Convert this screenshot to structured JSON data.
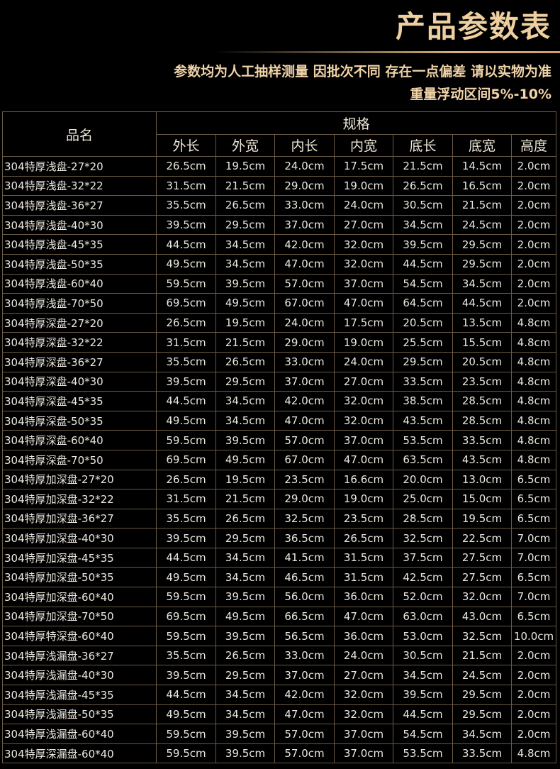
{
  "header": {
    "title": "产品参数表",
    "subtitle_line1": "参数均为人工抽样测量 因批次不同 存在一点偏差 请以实物为准",
    "subtitle_line2": "重量浮动区间5%-10%"
  },
  "table": {
    "name_header": "品名",
    "spec_header": "规格",
    "columns": [
      "外长",
      "外宽",
      "内长",
      "内宽",
      "底长",
      "底宽",
      "高度"
    ],
    "rows": [
      [
        "304特厚浅盘-27*20",
        "26.5cm",
        "19.5cm",
        "24.0cm",
        "17.5cm",
        "21.5cm",
        "14.5cm",
        "2.0cm"
      ],
      [
        "304特厚浅盘-32*22",
        "31.5cm",
        "21.5cm",
        "29.0cm",
        "19.0cm",
        "26.5cm",
        "16.5cm",
        "2.0cm"
      ],
      [
        "304特厚浅盘-36*27",
        "35.5cm",
        "26.5cm",
        "33.0cm",
        "24.0cm",
        "30.5cm",
        "21.5cm",
        "2.0cm"
      ],
      [
        "304特厚浅盘-40*30",
        "39.5cm",
        "29.5cm",
        "37.0cm",
        "27.0cm",
        "34.5cm",
        "24.5cm",
        "2.0cm"
      ],
      [
        "304特厚浅盘-45*35",
        "44.5cm",
        "34.5cm",
        "42.0cm",
        "32.0cm",
        "39.5cm",
        "29.5cm",
        "2.0cm"
      ],
      [
        "304特厚浅盘-50*35",
        "49.5cm",
        "34.5cm",
        "47.0cm",
        "32.0cm",
        "44.5cm",
        "29.5cm",
        "2.0cm"
      ],
      [
        "304特厚浅盘-60*40",
        "59.5cm",
        "39.5cm",
        "57.0cm",
        "37.0cm",
        "54.5cm",
        "34.5cm",
        "2.0cm"
      ],
      [
        "304特厚浅盘-70*50",
        "69.5cm",
        "49.5cm",
        "67.0cm",
        "47.0cm",
        "64.5cm",
        "44.5cm",
        "2.0cm"
      ],
      [
        "304特厚深盘-27*20",
        "26.5cm",
        "19.5cm",
        "24.0cm",
        "17.5cm",
        "20.5cm",
        "13.5cm",
        "4.8cm"
      ],
      [
        "304特厚深盘-32*22",
        "31.5cm",
        "21.5cm",
        "29.0cm",
        "19.0cm",
        "25.5cm",
        "15.5cm",
        "4.8cm"
      ],
      [
        "304特厚深盘-36*27",
        "35.5cm",
        "26.5cm",
        "33.0cm",
        "24.0cm",
        "29.5cm",
        "20.5cm",
        "4.8cm"
      ],
      [
        "304特厚深盘-40*30",
        "39.5cm",
        "29.5cm",
        "37.0cm",
        "27.0cm",
        "33.5cm",
        "23.5cm",
        "4.8cm"
      ],
      [
        "304特厚深盘-45*35",
        "44.5cm",
        "34.5cm",
        "42.0cm",
        "32.0cm",
        "38.5cm",
        "28.5cm",
        "4.8cm"
      ],
      [
        "304特厚深盘-50*35",
        "49.5cm",
        "34.5cm",
        "47.0cm",
        "32.0cm",
        "43.5cm",
        "28.5cm",
        "4.8cm"
      ],
      [
        "304特厚深盘-60*40",
        "59.5cm",
        "39.5cm",
        "57.0cm",
        "37.0cm",
        "53.5cm",
        "33.5cm",
        "4.8cm"
      ],
      [
        "304特厚深盘-70*50",
        "69.5cm",
        "49.5cm",
        "67.0cm",
        "47.0cm",
        "63.5cm",
        "43.5cm",
        "4.8cm"
      ],
      [
        "304特厚加深盘-27*20",
        "26.5cm",
        "19.5cm",
        "23.5cm",
        "16.6cm",
        "20.0cm",
        "13.0cm",
        "6.5cm"
      ],
      [
        "304特厚加深盘-32*22",
        "31.5cm",
        "21.5cm",
        "29.0cm",
        "19.0cm",
        "25.0cm",
        "15.0cm",
        "6.5cm"
      ],
      [
        "304特厚加深盘-36*27",
        "35.5cm",
        "26.5cm",
        "32.5cm",
        "23.5cm",
        "28.5cm",
        "19.5cm",
        "6.5cm"
      ],
      [
        "304特厚加深盘-40*30",
        "39.5cm",
        "29.5cm",
        "36.5cm",
        "26.5cm",
        "32.5cm",
        "22.5cm",
        "7.0cm"
      ],
      [
        "304特厚加深盘-45*35",
        "44.5cm",
        "34.5cm",
        "41.5cm",
        "31.5cm",
        "37.5cm",
        "27.5cm",
        "7.0cm"
      ],
      [
        "304特厚加深盘-50*35",
        "49.5cm",
        "34.5cm",
        "46.5cm",
        "31.5cm",
        "42.5cm",
        "27.5cm",
        "6.5cm"
      ],
      [
        "304特厚加深盘-60*40",
        "59.5cm",
        "39.5cm",
        "56.0cm",
        "36.0cm",
        "52.0cm",
        "32.0cm",
        "7.0cm"
      ],
      [
        "304特厚加深盘-70*50",
        "69.5cm",
        "49.5cm",
        "66.5cm",
        "47.0cm",
        "63.0cm",
        "43.0cm",
        "6.5cm"
      ],
      [
        "304特厚特深盘-60*40",
        "59.5cm",
        "39.5cm",
        "56.5cm",
        "36.0cm",
        "53.0cm",
        "32.5cm",
        "10.0cm"
      ],
      [
        "304特厚浅漏盘-36*27",
        "35.5cm",
        "26.5cm",
        "33.0cm",
        "24.0cm",
        "30.5cm",
        "21.5cm",
        "2.0cm"
      ],
      [
        "304特厚浅漏盘-40*30",
        "39.5cm",
        "29.5cm",
        "37.0cm",
        "27.0cm",
        "34.5cm",
        "24.5cm",
        "2.0cm"
      ],
      [
        "304特厚浅漏盘-45*35",
        "44.5cm",
        "34.5cm",
        "42.0cm",
        "32.0cm",
        "39.5cm",
        "29.5cm",
        "2.0cm"
      ],
      [
        "304特厚浅漏盘-50*35",
        "49.5cm",
        "34.5cm",
        "47.0cm",
        "32.0cm",
        "44.5cm",
        "29.5cm",
        "2.0cm"
      ],
      [
        "304特厚浅漏盘-60*40",
        "59.5cm",
        "39.5cm",
        "57.0cm",
        "37.0cm",
        "54.5cm",
        "34.5cm",
        "2.0cm"
      ],
      [
        "304特厚深漏盘-60*40",
        "59.5cm",
        "39.5cm",
        "57.0cm",
        "37.0cm",
        "53.5cm",
        "33.5cm",
        "4.8cm"
      ]
    ]
  }
}
